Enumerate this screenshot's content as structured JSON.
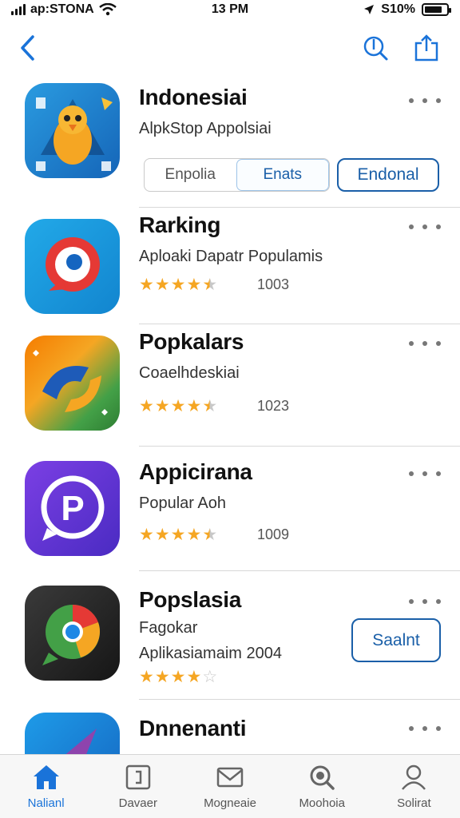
{
  "status_bar": {
    "carrier": "ap:STONA",
    "time": "13 PM",
    "battery": "S10%"
  },
  "nav": {
    "back_icon": "chevron-left-icon",
    "search_icon": "search-icon",
    "share_icon": "share-icon"
  },
  "colors": {
    "accent": "#1a5fa8",
    "tab_active": "#1a73d9",
    "star": "#f5a623"
  },
  "apps": [
    {
      "title": "Indonesiai",
      "subtitle": "AlpkStop Appolsiai",
      "segments": [
        "Enpolia",
        "Enats"
      ],
      "action_label": "Endonal"
    },
    {
      "title": "Rarking",
      "subtitle": "Aploaki Dapatr Populamis",
      "rating": 4.5,
      "count": "1003"
    },
    {
      "title": "Popkalars",
      "subtitle": "Coaelhdeskiai",
      "rating": 4.5,
      "count": "1023"
    },
    {
      "title": "Appicirana",
      "subtitle": "Popular  Aoh",
      "rating": 4.5,
      "count": "1009"
    },
    {
      "title": "Popslasia",
      "subtitle": "Fagokar",
      "subtitle2": "Aplikasiamaim  2004",
      "rating": 4,
      "action_label": "Saalnt"
    },
    {
      "title": "Dnnenanti"
    }
  ],
  "tabs": [
    {
      "label": "Nalianl",
      "icon": "home-icon",
      "active": true
    },
    {
      "label": "Davaer",
      "icon": "document-icon",
      "active": false
    },
    {
      "label": "Mogneaie",
      "icon": "mail-icon",
      "active": false
    },
    {
      "label": "Moohoia",
      "icon": "search-icon",
      "active": false
    },
    {
      "label": "Solirat",
      "icon": "person-icon",
      "active": false
    }
  ]
}
